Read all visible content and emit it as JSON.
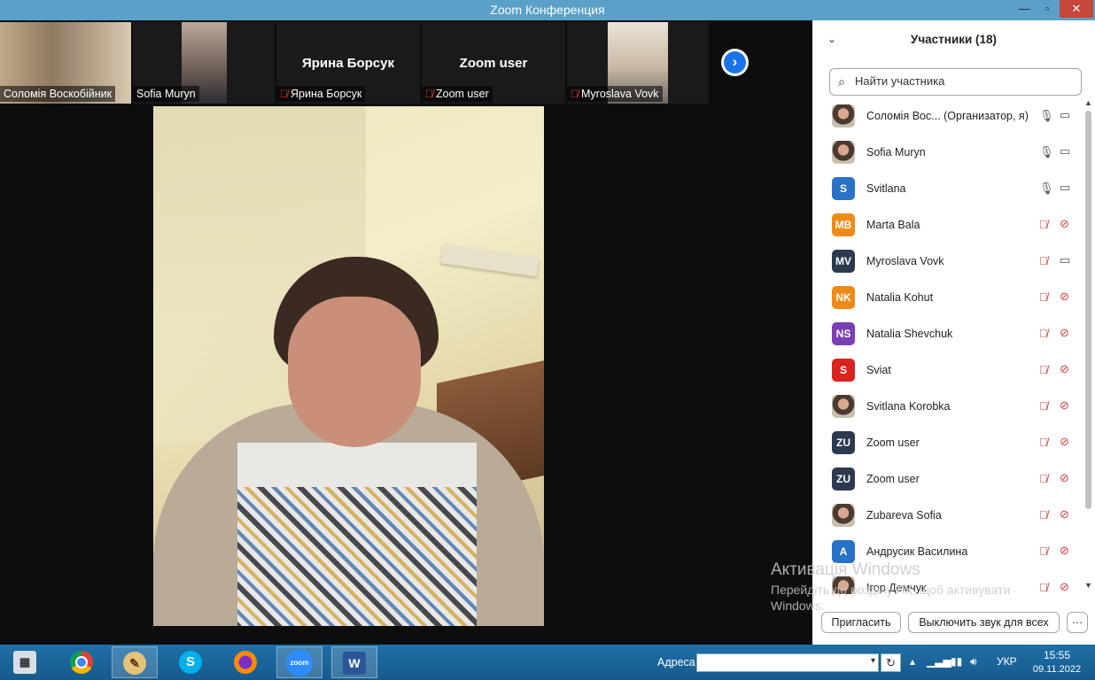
{
  "window": {
    "title": "Zoom Конференция"
  },
  "strip": {
    "tiles": [
      {
        "name": "Соломія Воскобійник",
        "muted": false,
        "has_video": true
      },
      {
        "name": "Sofia Muryn",
        "muted": false,
        "has_video": true
      },
      {
        "name": "Ярина Борсук",
        "muted": true,
        "has_video": false,
        "big_name": "Ярина Борсук"
      },
      {
        "name": "Zoom user",
        "muted": true,
        "has_video": false,
        "big_name": "Zoom user"
      },
      {
        "name": "Myroslava Vovk",
        "muted": true,
        "has_video": true
      }
    ],
    "next_arrow": "›"
  },
  "watermark": {
    "line1": "Активація Windows",
    "line2": "Перейдіть до розділу ПК, щоб активувати",
    "line3": "Windows."
  },
  "participants": {
    "title": "Участники (18)",
    "search_placeholder": "Найти участника",
    "items": [
      {
        "name": "Соломія Вос... (Организатор, я)",
        "avatar_text": "",
        "avatar_color": "photo",
        "mic": "on",
        "cam": "on"
      },
      {
        "name": "Sofia Muryn",
        "avatar_text": "",
        "avatar_color": "photo",
        "mic": "on",
        "cam": "on"
      },
      {
        "name": "Svitlana",
        "avatar_text": "S",
        "avatar_color": "#2a72c8",
        "mic": "on",
        "cam": "on"
      },
      {
        "name": "Marta Bala",
        "avatar_text": "MB",
        "avatar_color": "#f08a16",
        "mic": "off",
        "cam": "off"
      },
      {
        "name": "Myroslava Vovk",
        "avatar_text": "MV",
        "avatar_color": "#2b3a4e",
        "mic": "off",
        "cam": "on"
      },
      {
        "name": "Natalia Kohut",
        "avatar_text": "NK",
        "avatar_color": "#f08a16",
        "mic": "off",
        "cam": "off"
      },
      {
        "name": "Natalia Shevchuk",
        "avatar_text": "NS",
        "avatar_color": "#7b3fb5",
        "mic": "off",
        "cam": "off"
      },
      {
        "name": "Sviat",
        "avatar_text": "S",
        "avatar_color": "#d9231e",
        "mic": "off",
        "cam": "off"
      },
      {
        "name": "Svitlana Korobka",
        "avatar_text": "",
        "avatar_color": "photo",
        "mic": "off",
        "cam": "off"
      },
      {
        "name": "Zoom user",
        "avatar_text": "ZU",
        "avatar_color": "#2b3a4e",
        "mic": "off",
        "cam": "off"
      },
      {
        "name": "Zoom user",
        "avatar_text": "ZU",
        "avatar_color": "#2b3a4e",
        "mic": "off",
        "cam": "off"
      },
      {
        "name": "Zubareva Sofia",
        "avatar_text": "",
        "avatar_color": "photo",
        "mic": "off",
        "cam": "off"
      },
      {
        "name": "Андрусик Василина",
        "avatar_text": "A",
        "avatar_color": "#2a72c8",
        "mic": "off",
        "cam": "off"
      },
      {
        "name": "Ігор Демчук",
        "avatar_text": "",
        "avatar_color": "photo",
        "mic": "off",
        "cam": "off"
      }
    ],
    "invite_label": "Пригласить",
    "mute_all_label": "Выключить звук для всех",
    "more_label": "···"
  },
  "taskbar": {
    "address_label": "Адреса",
    "address_value": "",
    "lang": "УКР",
    "time": "15:55",
    "date": "09.11.2022",
    "apps": [
      "calculator-icon",
      "chrome-icon",
      "paint-icon",
      "skype-icon",
      "firefox-icon",
      "zoom-icon",
      "word-icon"
    ]
  },
  "colors": {
    "accent": "#1a73e8",
    "muted_red": "#d23a3a",
    "taskbar": "#1f6fa8",
    "titlebar": "#5aa0c9"
  }
}
